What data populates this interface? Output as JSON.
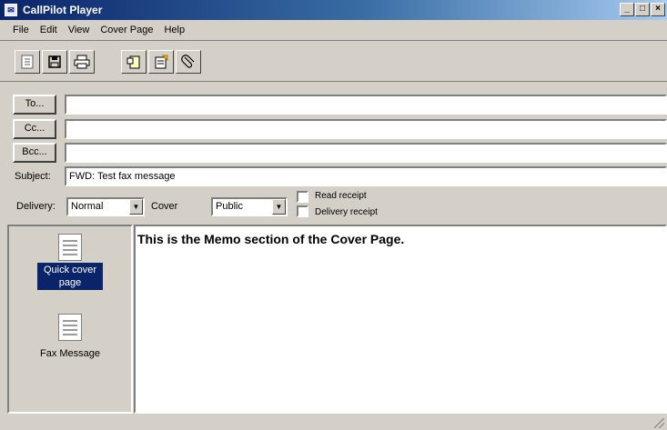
{
  "window": {
    "title": "CallPilot Player",
    "buttons": [
      "_",
      "□",
      "×"
    ]
  },
  "menu": [
    "File",
    "Edit",
    "View",
    "Cover Page",
    "Help"
  ],
  "toolbar": {
    "group1": [
      "fax-viewer-icon",
      "save-icon",
      "print-icon"
    ],
    "group2": [
      "cover-page-icon",
      "notes-icon",
      "attach-icon"
    ]
  },
  "address": {
    "to_label": "To...",
    "cc_label": "Cc...",
    "bcc_label": "Bcc...",
    "to_value": "",
    "cc_value": "",
    "bcc_value": ""
  },
  "subject": {
    "label": "Subject:",
    "value": "FWD: Test fax message"
  },
  "delivery": {
    "label": "Delivery:",
    "value": "Normal"
  },
  "cover": {
    "label": "Cover",
    "value": "Public"
  },
  "options": {
    "read_receipt": "Read receipt",
    "delivery_receipt": "Delivery receipt",
    "read_checked": false,
    "delivery_checked": false
  },
  "cover_pages": [
    {
      "label": "Quick cover page",
      "selected": true,
      "icon": "cover-page-icon"
    },
    {
      "label": "Fax Message",
      "selected": false,
      "icon": "fax-message-icon"
    }
  ],
  "memo": {
    "text": "This is the Memo section of the Cover Page."
  }
}
